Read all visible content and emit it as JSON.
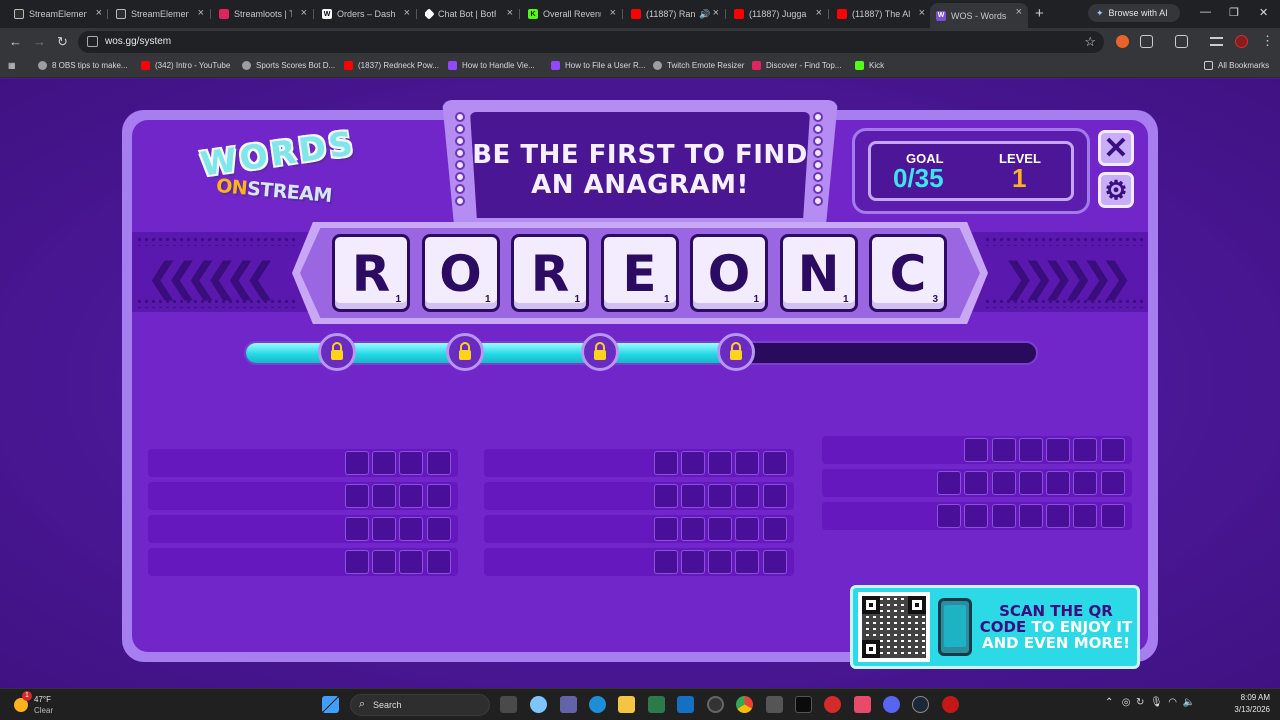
{
  "browser": {
    "tabs": [
      {
        "label": "StreamElements",
        "icon": "streamelements-icon",
        "color": "#2d2d2d"
      },
      {
        "label": "StreamElements",
        "icon": "streamelements-icon",
        "color": "#2d2d2d"
      },
      {
        "label": "Streamloots | Th",
        "icon": "streamloots-icon",
        "color": "#e0245e"
      },
      {
        "label": "Orders – Dashb",
        "icon": "orders-icon",
        "color": "#ffffff"
      },
      {
        "label": "Chat Bot | BotRi",
        "icon": "botrix-icon",
        "color": "#ffffff"
      },
      {
        "label": "Overall Revenue",
        "icon": "kick-icon",
        "color": "#53fc18"
      },
      {
        "label": "(11887) Ran",
        "icon": "youtube-icon",
        "color": "#ff0000"
      },
      {
        "label": "(11887) Juggalo",
        "icon": "youtube-icon",
        "color": "#ff0000"
      },
      {
        "label": "(11887) The All",
        "icon": "youtube-icon",
        "color": "#ff0000"
      },
      {
        "label": "WOS - Words O",
        "icon": "wos-icon",
        "color": "#7b4ed8"
      }
    ],
    "ai_button": "Browse with AI",
    "url": "wos.gg/system",
    "bookmarks": [
      {
        "label": "8 OBS tips to make...",
        "color": "#9e9e9e"
      },
      {
        "label": "(342) Intro - YouTube",
        "color": "#ff0000"
      },
      {
        "label": "Sports Scores Bot D...",
        "color": "#9e9e9e"
      },
      {
        "label": "(1837) Redneck Pow...",
        "color": "#ff0000"
      },
      {
        "label": "How to Handle Vie...",
        "color": "#9146ff"
      },
      {
        "label": "How to File a User R...",
        "color": "#9146ff"
      },
      {
        "label": "Twitch Emote Resizer",
        "color": "#9e9e9e"
      },
      {
        "label": "Discover - Find Top...",
        "color": "#e0245e"
      },
      {
        "label": "Kick",
        "color": "#53fc18"
      }
    ],
    "all_bookmarks": "All Bookmarks"
  },
  "game": {
    "logo_top": "WORDS",
    "logo_on": "ON",
    "logo_stream": "STREAM",
    "headline_line1": "BE THE FIRST TO FIND",
    "headline_line2": "AN ANAGRAM!",
    "goal_label": "GOAL",
    "goal_value": "0/35",
    "level_label": "LEVEL",
    "level_value": "1",
    "tiles": [
      {
        "letter": "R",
        "score": "1"
      },
      {
        "letter": "O",
        "score": "1"
      },
      {
        "letter": "R",
        "score": "1"
      },
      {
        "letter": "E",
        "score": "1"
      },
      {
        "letter": "O",
        "score": "1"
      },
      {
        "letter": "N",
        "score": "1"
      },
      {
        "letter": "C",
        "score": "3"
      }
    ],
    "progress_fraction": 0.62,
    "locks_count": 4,
    "word_columns": [
      {
        "rows": 4,
        "letters": 4
      },
      {
        "rows": 4,
        "letters": 5
      },
      {
        "rows": 1,
        "letters": 6
      },
      {
        "rows": 2,
        "letters": 7
      }
    ],
    "qr_line1": "SCAN THE QR",
    "qr_line2_a": "CODE",
    "qr_line2_b": "TO ENJOY IT",
    "qr_line3": "AND EVEN MORE!",
    "accent_color": "#2cd9e6",
    "gold_color": "#ffb21c"
  },
  "taskbar": {
    "weather_temp": "47°F",
    "weather_cond": "Clear",
    "weather_badge": "1",
    "search_label": "Search",
    "time": "8:09 AM",
    "date": "3/13/2026"
  }
}
